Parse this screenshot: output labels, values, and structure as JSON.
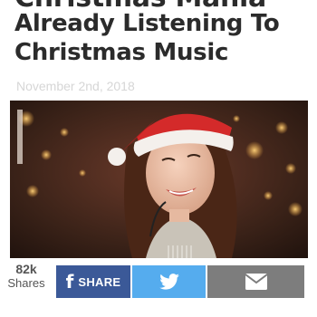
{
  "article": {
    "headline_partial": "Christmas Mania",
    "headline": "Already Listening To Christmas Music",
    "date": "November 2nd, 2018"
  },
  "share": {
    "count": "82k",
    "count_label": "Shares",
    "facebook_label": "SHARE",
    "colors": {
      "facebook": "#3b5998",
      "twitter": "#55acee",
      "email": "#7d7d7d"
    }
  }
}
